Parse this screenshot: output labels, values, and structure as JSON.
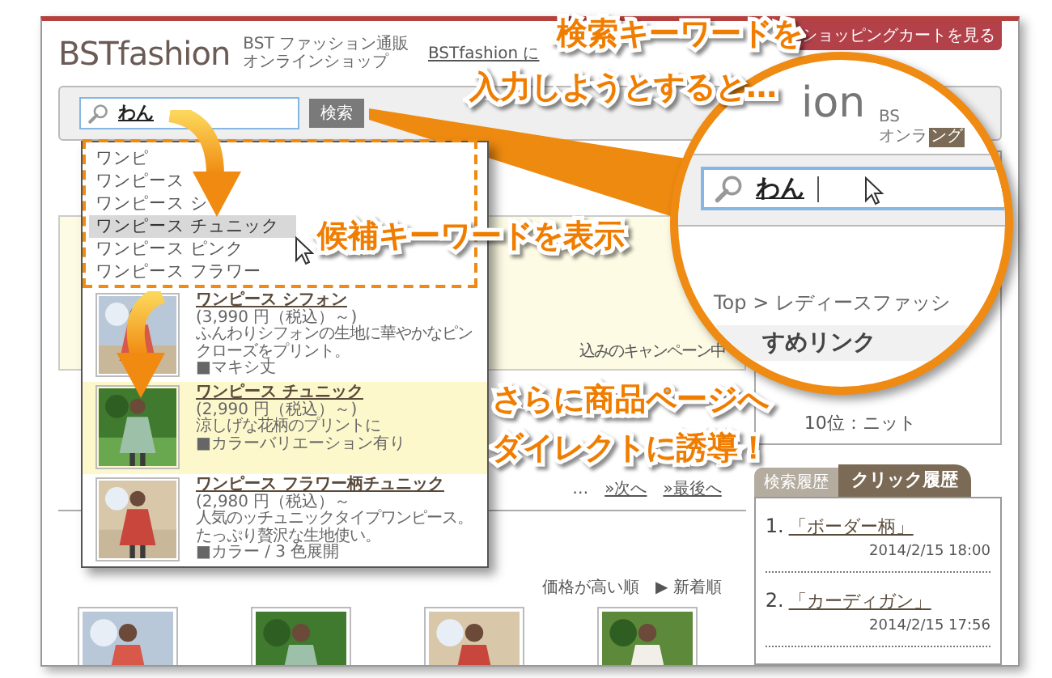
{
  "header": {
    "logo": "BSTfashion",
    "tagline": [
      "BST ファッション通販",
      "オンラインショップ"
    ],
    "link": "BSTfashion に",
    "cart_tab": "ショッピングカートを見る"
  },
  "search": {
    "value": "わん",
    "button": "検索"
  },
  "suggestions": [
    {
      "text": "ワンピ",
      "selected": false
    },
    {
      "text": "ワンピース",
      "selected": false
    },
    {
      "text": "ワンピース シ",
      "selected": false
    },
    {
      "text": "ワンピース チュニック",
      "selected": true
    },
    {
      "text": "ワンピース ピンク",
      "selected": false
    },
    {
      "text": "ワンピース フラワー",
      "selected": false
    }
  ],
  "results": [
    {
      "title": "ワンピース シフォン",
      "price": "(3,990 円（税込）～)",
      "description": "ふんわりシフォンの生地に華やかなピンクローズをプリント。",
      "note": "■マキシ丈",
      "selected": false
    },
    {
      "title": "ワンピース チュニック",
      "price": "(2,990 円（税込）～)",
      "description": "涼しげな花柄のプリントに",
      "note": "■カラーバリエーション有り",
      "selected": true
    },
    {
      "title": "ワンピース フラワー柄チュニック",
      "price": "(2,980 円（税込）～",
      "description": "人気のッチュニックタイプワンピース。たっぷり贅沢な生地使い。",
      "note": "■カラー / 3 色展開",
      "selected": false
    }
  ],
  "page": {
    "campaign": "込みのキャンペーン中",
    "pagination": [
      "…",
      "»次へ",
      "»最後へ"
    ],
    "sort": [
      "価格が高い順",
      "▶ 新着順"
    ]
  },
  "magnifier": {
    "logo_part": "ion",
    "tagline": [
      "BS",
      "オンラ"
    ],
    "tab": "ング",
    "search_value": "わん",
    "breadcrumb": "Top > レディースファッシ",
    "section": "すめリンク"
  },
  "ranking": [
    "10位：ニット"
  ],
  "history": {
    "tabs": [
      {
        "label": "検索履歴",
        "selected": false
      },
      {
        "label": "クリック履歴",
        "selected": true
      }
    ],
    "entries": [
      {
        "index": "1.",
        "keyword": "「ボーダー柄」",
        "time": "2014/2/15 18:00"
      },
      {
        "index": "2.",
        "keyword": "「カーディガン」",
        "time": "2014/2/15 17:56"
      }
    ]
  },
  "callouts": [
    {
      "lines": [
        "検索キーワードを",
        "入力しようとすると…"
      ]
    },
    {
      "lines": [
        "候補キーワードを表示"
      ]
    },
    {
      "lines": [
        "さらに商品ページへ",
        "ダイレクトに誘導！"
      ]
    }
  ]
}
